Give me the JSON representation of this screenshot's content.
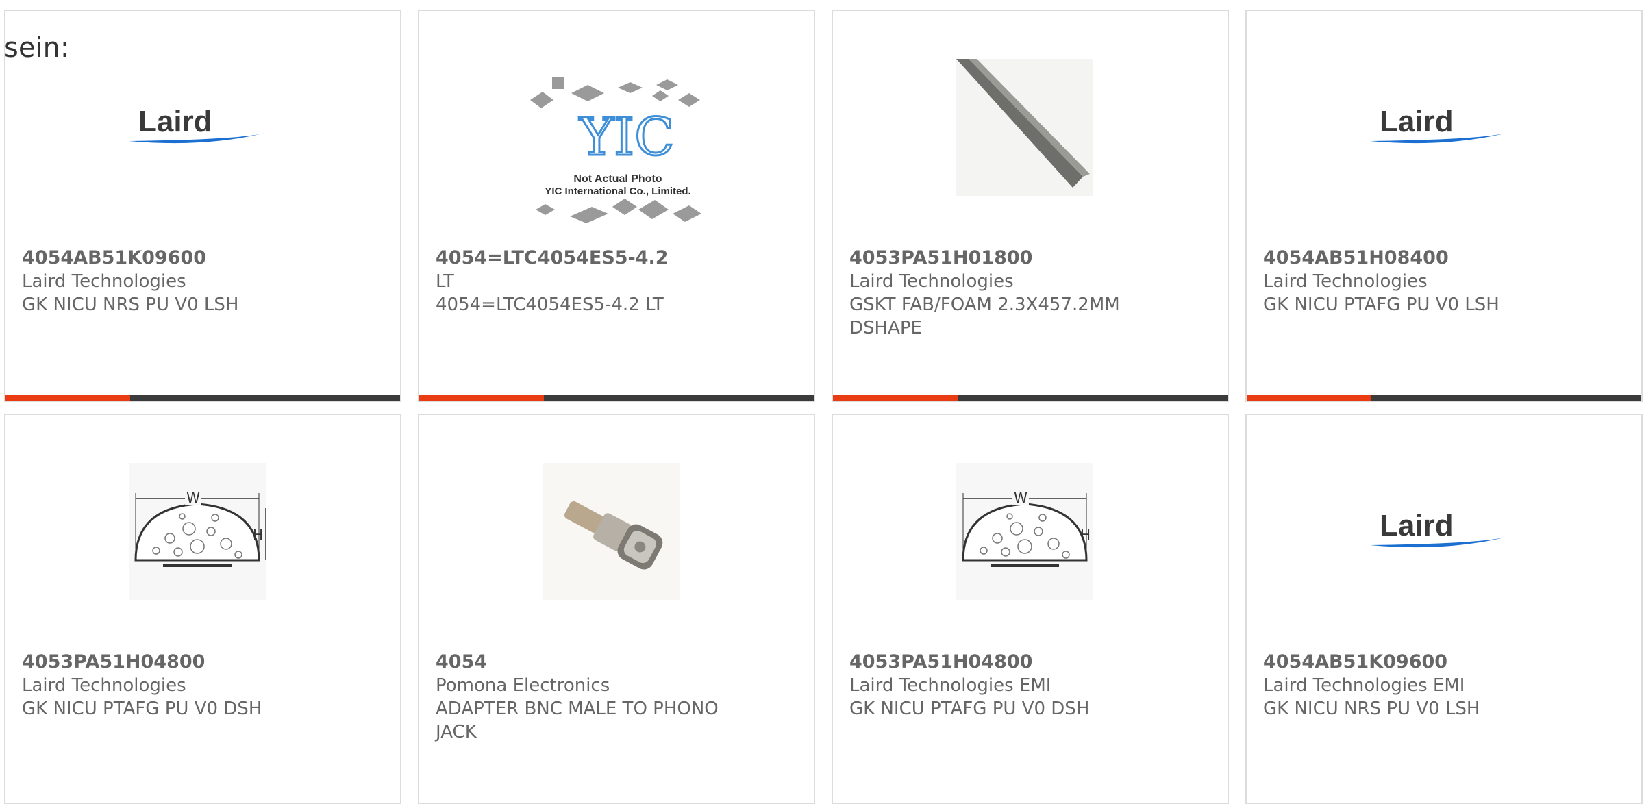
{
  "intro_text": "sein:",
  "colors": {
    "accent": "#ea3c13",
    "bar": "#3b3b3b",
    "border": "#dcdcdc",
    "text": "#666666",
    "laird_blue": "#1a6fd1"
  },
  "cards": [
    {
      "part": "4054AB51K09600",
      "manufacturer": "Laird Technologies",
      "description": "GK NICU NRS PU V0 LSH",
      "image": "laird-logo",
      "logo_text": "Laird"
    },
    {
      "part": "4054=LTC4054ES5-4.2",
      "manufacturer": "LT",
      "description": "4054=LTC4054ES5-4.2 LT",
      "image": "yic-placeholder",
      "logo_text": "YIC",
      "photo_note": "Not Actual Photo",
      "photo_company": "YIC International Co., Limited."
    },
    {
      "part": "4053PA51H01800",
      "manufacturer": "Laird Technologies",
      "description": "GSKT FAB/FOAM 2.3X457.2MM DSHAPE",
      "image": "gasket-rod"
    },
    {
      "part": "4054AB51H08400",
      "manufacturer": "Laird Technologies",
      "description": "GK NICU PTAFG PU V0 LSH",
      "image": "laird-logo",
      "logo_text": "Laird"
    },
    {
      "part": "4053PA51H04800",
      "manufacturer": "Laird Technologies",
      "description": "GK NICU PTAFG PU V0 DSH",
      "image": "dshape-drawing",
      "dim_w": "W",
      "dim_h": "H"
    },
    {
      "part": "4054",
      "manufacturer": "Pomona Electronics",
      "description": "ADAPTER BNC MALE TO PHONO JACK",
      "image": "bnc-adapter"
    },
    {
      "part": "4053PA51H04800",
      "manufacturer": "Laird Technologies EMI",
      "description": "GK NICU PTAFG PU V0 DSH",
      "image": "dshape-drawing",
      "dim_w": "W",
      "dim_h": "H"
    },
    {
      "part": "4054AB51K09600",
      "manufacturer": "Laird Technologies EMI",
      "description": "GK NICU NRS PU V0 LSH",
      "image": "laird-logo",
      "logo_text": "Laird"
    }
  ]
}
